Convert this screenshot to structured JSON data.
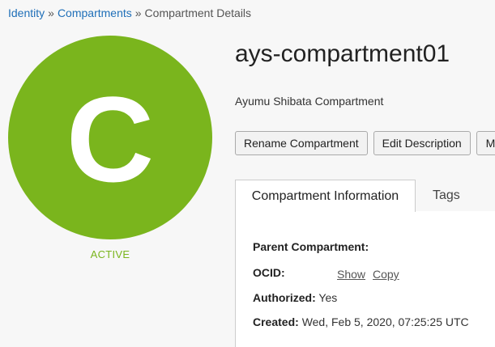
{
  "breadcrumb": {
    "items": [
      {
        "label": "Identity"
      },
      {
        "label": "Compartments"
      }
    ],
    "separator": "»",
    "current": "Compartment Details"
  },
  "compartment": {
    "initial": "C",
    "status": "ACTIVE",
    "name": "ays-compartment01",
    "description": "Ayumu Shibata Compartment",
    "accent_color": "#7ab51d"
  },
  "actions": {
    "rename": "Rename Compartment",
    "edit_description": "Edit Description",
    "more": "M"
  },
  "tabs": {
    "info": "Compartment Information",
    "tags": "Tags"
  },
  "info": {
    "parent_label": "Parent Compartment:",
    "parent_value": "",
    "ocid_label": "OCID:",
    "ocid_show": "Show",
    "ocid_copy": "Copy",
    "authorized_label": "Authorized:",
    "authorized_value": "Yes",
    "created_label": "Created:",
    "created_value": "Wed, Feb 5, 2020, 07:25:25 UTC"
  }
}
